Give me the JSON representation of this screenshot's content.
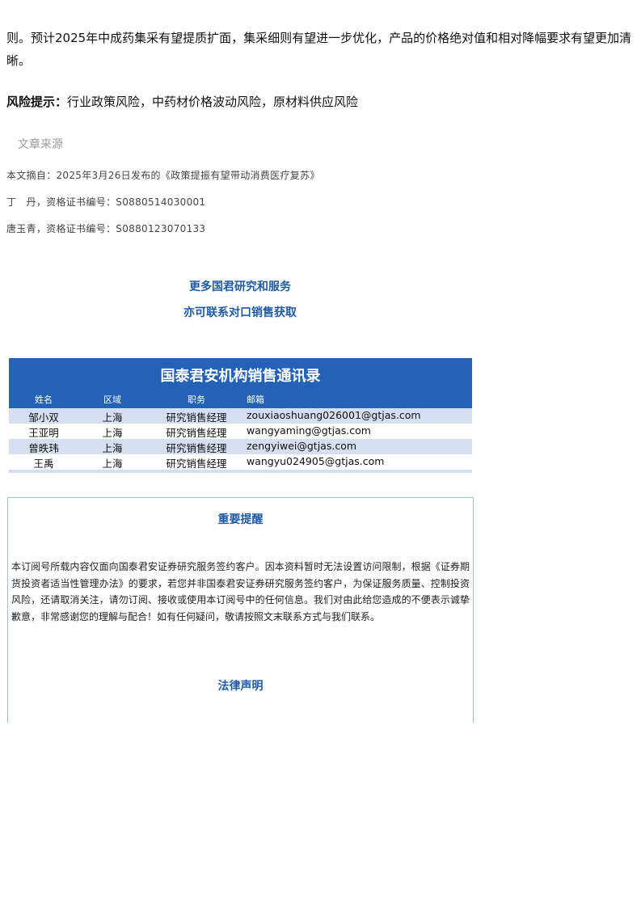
{
  "intro_text": "则。预计2025年中成药集采有望提质扩面，集采细则有望进一步优化，产品的价格绝对值和相对降幅要求有望更加清晰。",
  "risk": {
    "label": "风险提示：",
    "text": "行业政策风险，中药材价格波动风险，原材料供应风险"
  },
  "source": {
    "title": "文章来源",
    "excerpt": "本文摘自：2025年3月26日发布的《政策提振有望带动消费医疗复苏》",
    "analyst_1": "丁　丹，资格证书编号：S0880514030001",
    "analyst_2": "唐玉青，资格证书编号：S0880123070133"
  },
  "more": {
    "line1": "更多国君研究和服务",
    "line2": "亦可联系对口销售获取"
  },
  "directory": {
    "title": "国泰君安机构销售通讯录",
    "columns": [
      "姓名",
      "区域",
      "职务",
      "邮箱"
    ],
    "rows": [
      [
        "邹小双",
        "上海",
        "研究销售经理",
        "zouxiaoshuang026001@gtjas.com"
      ],
      [
        "王亚明",
        "上海",
        "研究销售经理",
        "wangyaming@gtjas.com"
      ],
      [
        "曾昳玮",
        "上海",
        "研究销售经理",
        "zengyiwei@gtjas.com"
      ],
      [
        "王禹",
        "上海",
        "研究销售经理",
        "wangyu024905@gtjas.com"
      ]
    ]
  },
  "notice": {
    "title": "重要提醒",
    "body": "本订阅号所载内容仅面向国泰君安证券研究服务签约客户。因本资料暂时无法设置访问限制，根据《证券期货投资者适当性管理办法》的要求，若您并非国泰君安证券研究服务签约客户，为保证服务质量、控制投资风险，还请取消关注，请勿订阅、接收或使用本订阅号中的任何信息。我们对由此给您造成的不便表示诚挚歉意，非常感谢您的理解与配合！如有任何疑问，敬请按照文末联系方式与我们联系。",
    "legal_title": "法律声明"
  }
}
